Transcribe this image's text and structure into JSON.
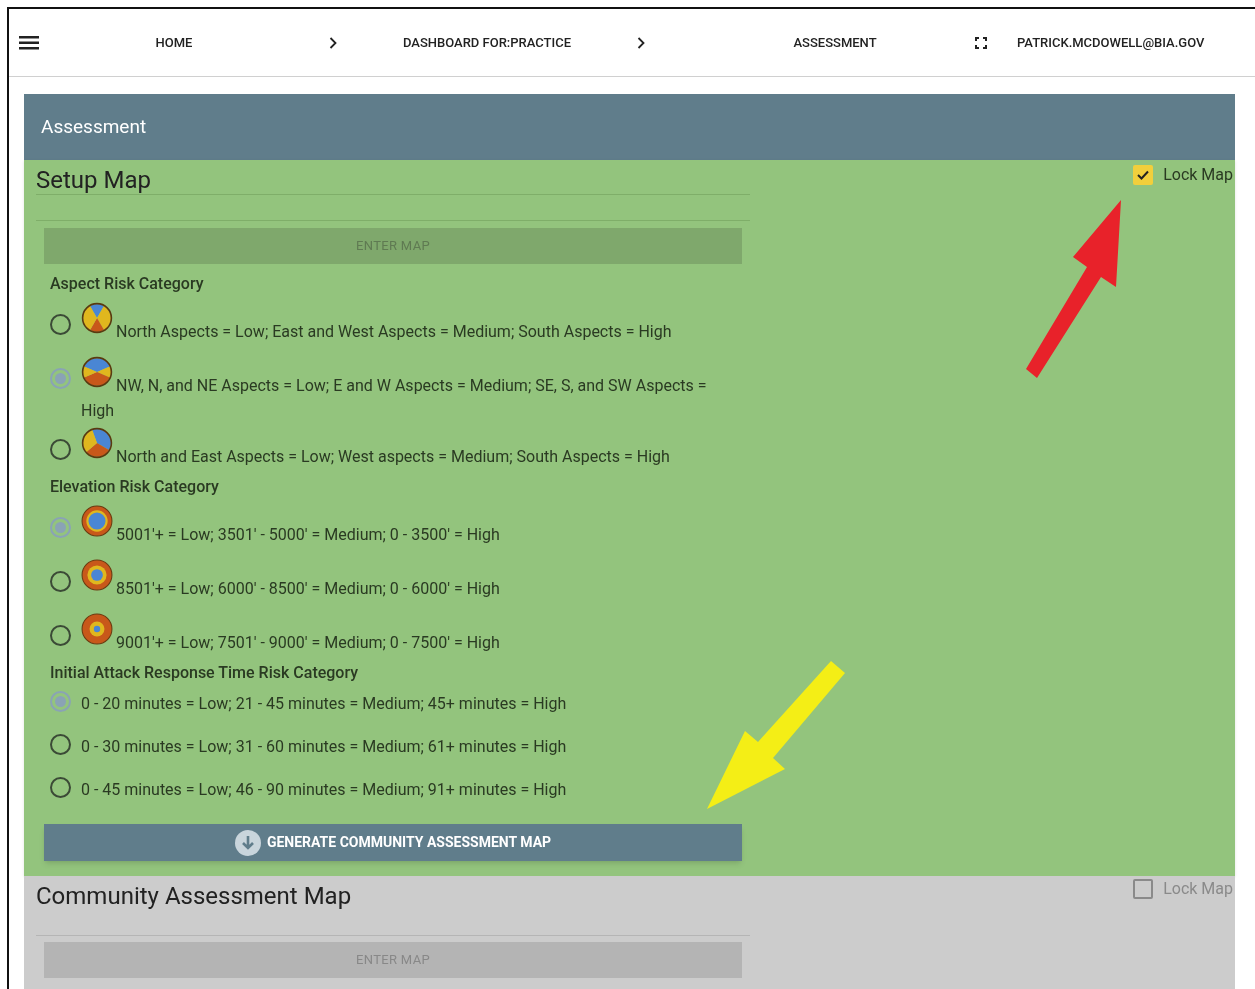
{
  "nav": {
    "items": [
      {
        "label": "HOME"
      },
      {
        "label": "DASHBOARD FOR:PRACTICE"
      },
      {
        "label": "ASSESSMENT"
      }
    ],
    "user": "PATRICK.MCDOWELL@BIA.GOV"
  },
  "page_title": "Assessment",
  "setup": {
    "title": "Setup Map",
    "lock_map": {
      "label": "Lock Map",
      "checked": true
    },
    "enter_map": {
      "label": "ENTER MAP",
      "disabled": true
    },
    "groups": [
      {
        "title": "Aspect Risk Category",
        "kind": "aspect",
        "options": [
          {
            "label": "North Aspects = Low; East and West Aspects = Medium; South Aspects = High",
            "selected": false
          },
          {
            "label": "NW, N, and NE Aspects = Low; E and W Aspects = Medium; SE, S, and SW Aspects = High",
            "selected": true
          },
          {
            "label": "North and East Aspects = Low; West aspects = Medium; South Aspects = High",
            "selected": false
          }
        ]
      },
      {
        "title": "Elevation Risk Category",
        "kind": "elevation",
        "options": [
          {
            "label": "5001'+ = Low; 3501' - 5000' = Medium; 0 - 3500' = High",
            "selected": true
          },
          {
            "label": "8501'+ = Low; 6000' - 8500' = Medium; 0 - 6000' = High",
            "selected": false
          },
          {
            "label": "9001'+ = Low; 7501' - 9000' = Medium; 0 - 7500' = High",
            "selected": false
          }
        ]
      },
      {
        "title": "Initial Attack Response Time Risk Category",
        "kind": "plain",
        "options": [
          {
            "label": "0 - 20 minutes = Low; 21 - 45 minutes = Medium; 45+ minutes = High",
            "selected": true
          },
          {
            "label": "0 - 30 minutes = Low; 31 - 60 minutes = Medium; 61+ minutes = High",
            "selected": false
          },
          {
            "label": "0 - 45 minutes = Low; 46 - 90 minutes = Medium; 91+ minutes = High",
            "selected": false
          }
        ]
      }
    ],
    "generate_button": "GENERATE COMMUNITY ASSESSMENT MAP"
  },
  "community": {
    "title": "Community Assessment Map",
    "lock_map": {
      "label": "Lock Map",
      "checked": false
    },
    "enter_map": {
      "label": "ENTER MAP",
      "disabled": true
    }
  }
}
